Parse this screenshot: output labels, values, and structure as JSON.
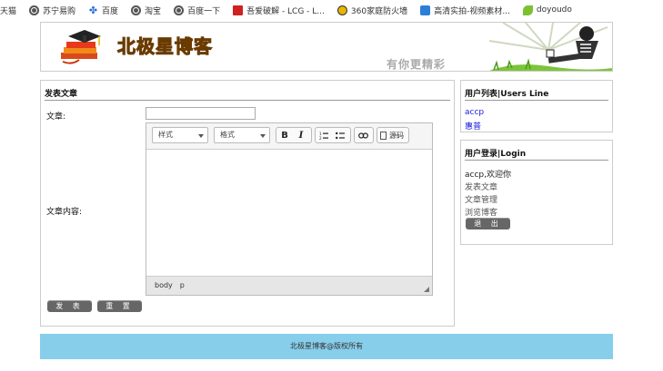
{
  "bookmarks": [
    {
      "label": "天猫",
      "icon": "none"
    },
    {
      "label": "苏宁易购",
      "icon": "globe-icon"
    },
    {
      "label": "百度",
      "icon": "baidu-paw-icon"
    },
    {
      "label": "淘宝",
      "icon": "globe-icon"
    },
    {
      "label": "百度一下",
      "icon": "globe-icon"
    },
    {
      "label": "吾爱破解 - LCG - L...",
      "icon": "red-square-icon"
    },
    {
      "label": "360家庭防火墙",
      "icon": "yellow-circle-icon"
    },
    {
      "label": "高清实拍-视频素材...",
      "icon": "blue-tile-icon"
    },
    {
      "label": "doyoudo",
      "icon": "leaf-icon"
    }
  ],
  "header": {
    "site_title": "北极星博客",
    "slogan": "有你更精彩"
  },
  "post_form": {
    "panel_title": "发表文章",
    "title_label": "文章:",
    "content_label": "文章内容:",
    "title_value": "",
    "editor": {
      "style_combo": "样式",
      "format_combo": "格式",
      "bold": "B",
      "italic": "I",
      "source_label": "源码",
      "path": [
        "body",
        "p"
      ]
    },
    "submit_label": "发 表",
    "reset_label": "重 置"
  },
  "users_panel": {
    "title": "用户列表|Users Line",
    "users": [
      "accp",
      "惠普"
    ]
  },
  "login_panel": {
    "title": "用户登录|Login",
    "welcome": "accp,欢迎你",
    "menu": [
      "发表文章",
      "文章管理",
      "浏览博客"
    ],
    "logout_label": "退 出"
  },
  "footer": {
    "text": "北极星博客@版权所有"
  },
  "colors": {
    "footer_bg": "#87ceeb",
    "button_bg": "#666666",
    "link": "#1a1ae0",
    "title_gold": "#e8b400"
  }
}
